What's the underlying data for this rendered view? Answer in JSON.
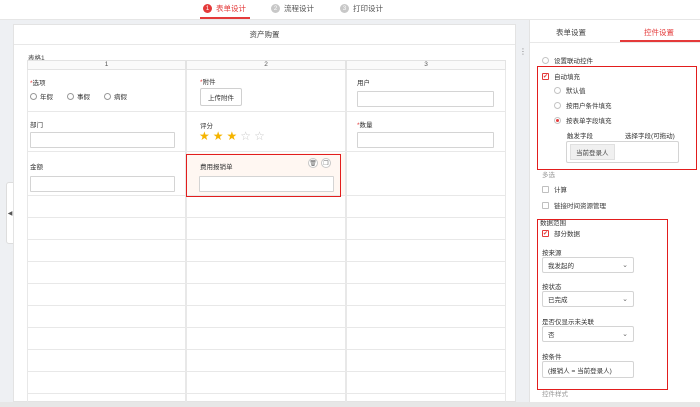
{
  "steps": [
    {
      "num": "1",
      "label": "表单设计",
      "active": true
    },
    {
      "num": "2",
      "label": "流程设计",
      "active": false
    },
    {
      "num": "3",
      "label": "打印设计",
      "active": false
    }
  ],
  "form": {
    "title": "资产购置",
    "table_name": "表格1",
    "columns": [
      "1",
      "2",
      "3"
    ],
    "fields": {
      "options_label": "选项",
      "options": [
        "年假",
        "事假",
        "病假"
      ],
      "attachment_label": "附件",
      "upload_button": "上传附件",
      "user_label": "用户",
      "department_label": "部门",
      "rating_label": "评分",
      "rating_value": 3,
      "rating_max": 5,
      "quantity_label": "数量",
      "amount_label": "金额",
      "expense_form_label": "费用报销单"
    }
  },
  "panel": {
    "tabs": [
      "表单设置",
      "控件设置"
    ],
    "active_tab": "控件设置",
    "link_control": "设置联动控件",
    "auto_fill": {
      "label": "自动填充",
      "checked": true,
      "options": [
        "默认值",
        "按用户条件填充",
        "按表单字段填充"
      ],
      "selected": "按表单字段填充",
      "trigger_label": "触发字段",
      "select_field_link": "选择字段(可拖动)",
      "trigger_tag": "当前登录人"
    },
    "multi_label": "多选",
    "calc_label": "计算",
    "link_time_label": "链接时间资源管理",
    "data_scope": {
      "section": "数据范围",
      "partial_label": "部分数据",
      "partial_checked": true,
      "source_label": "按来源",
      "source_value": "我发起的",
      "status_label": "按状态",
      "status_value": "已完成",
      "related_label": "是否仅显示未关联",
      "related_value": "否",
      "condition_label": "按条件",
      "condition_value": "(报销人 = 当前登录人)"
    },
    "control_style": "控件样式"
  }
}
